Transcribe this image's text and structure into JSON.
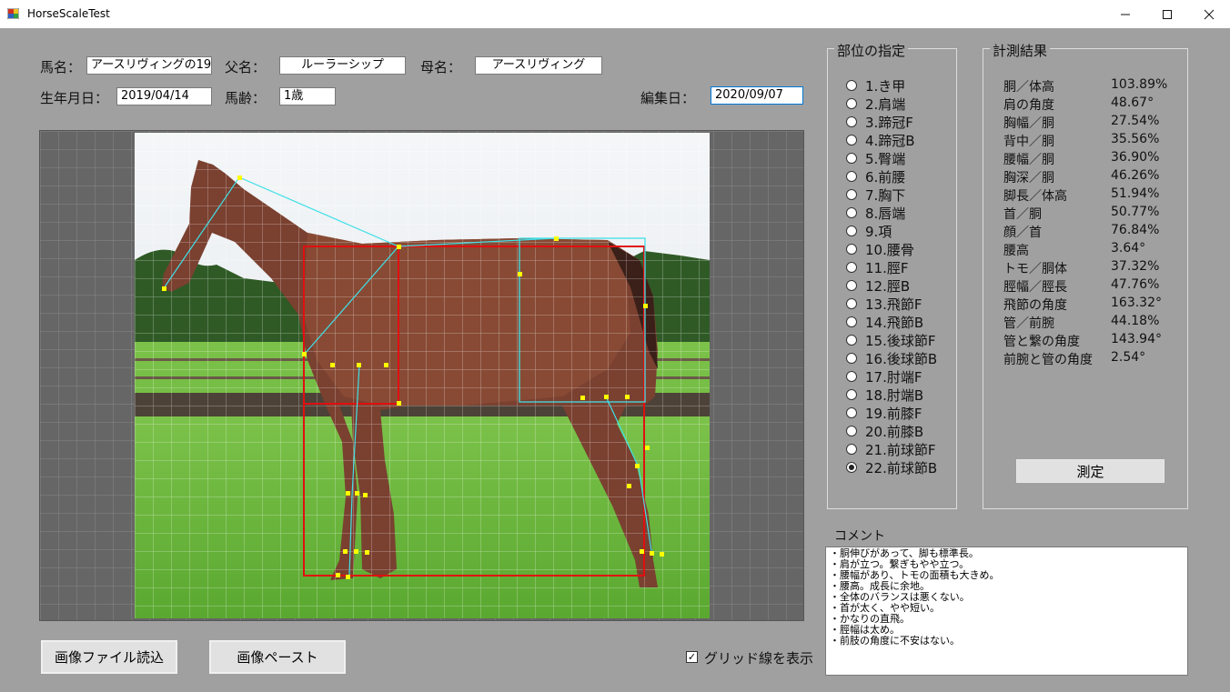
{
  "window": {
    "title": "HorseScaleTest"
  },
  "info": {
    "horse_name_label": "馬名：",
    "horse_name": "アースリヴィングの19",
    "sire_label": "父名：",
    "sire": "ルーラーシップ",
    "dam_label": "母名：",
    "dam": "アースリヴィング",
    "birth_label": "生年月日：",
    "birth": "2019/04/14",
    "age_label": "馬齢：",
    "age": "1歳",
    "edit_label": "編集日：",
    "edit_date": "2020/09/07"
  },
  "parts": {
    "title": "部位の指定",
    "selected_index": 21,
    "items": [
      "1.き甲",
      "2.肩端",
      "3.蹄冠F",
      "4.蹄冠B",
      "5.臀端",
      "6.前腰",
      "7.胸下",
      "8.唇端",
      "9.項",
      "10.腰骨",
      "11.脛F",
      "12.脛B",
      "13.飛節F",
      "14.飛節B",
      "15.後球節F",
      "16.後球節B",
      "17.肘端F",
      "18.肘端B",
      "19.前膝F",
      "20.前膝B",
      "21.前球節F",
      "22.前球節B"
    ]
  },
  "results": {
    "title": "計測結果",
    "rows": [
      {
        "name": "胴／体高",
        "value": "103.89%"
      },
      {
        "name": "肩の角度",
        "value": "48.67°"
      },
      {
        "name": "胸幅／胴",
        "value": "27.54%"
      },
      {
        "name": "背中／胴",
        "value": "35.56%"
      },
      {
        "name": "腰幅／胴",
        "value": "36.90%"
      },
      {
        "name": "胸深／胴",
        "value": "46.26%"
      },
      {
        "name": "脚長／体高",
        "value": "51.94%"
      },
      {
        "name": "首／胴",
        "value": "50.77%"
      },
      {
        "name": "顔／首",
        "value": "76.84%"
      },
      {
        "name": "腰高",
        "value": "3.64°"
      },
      {
        "name": "トモ／胴体",
        "value": "37.32%"
      },
      {
        "name": "脛幅／脛長",
        "value": "47.76%"
      },
      {
        "name": "飛節の角度",
        "value": "163.32°"
      },
      {
        "name": "管／前腕",
        "value": "44.18%"
      },
      {
        "name": "管と繋の角度",
        "value": "143.94°"
      },
      {
        "name": "前腕と管の角度",
        "value": "2.54°"
      }
    ],
    "measure_button": "測定"
  },
  "comment": {
    "label": "コメント",
    "lines": [
      "・胴伸びがあって、脚も標準長。",
      "・肩が立つ。繋ぎもやや立つ。",
      "・腰幅があり、トモの面積も大きめ。",
      "・腰高。成長に余地。",
      "・全体のバランスは悪くない。",
      "・首が太く、やや短い。",
      "・かなりの直飛。",
      "・脛幅は太め。",
      "・前肢の角度に不安はない。"
    ]
  },
  "buttons": {
    "load_image": "画像ファイル読込",
    "paste_image": "画像ペースト"
  },
  "grid_checkbox": {
    "label": "グリッド線を表示",
    "checked": true
  },
  "colors": {
    "background": "#a0a0a0",
    "box_red": "#e01010",
    "line_cyan": "#40e0e8",
    "point_yellow": "#ffff00"
  }
}
